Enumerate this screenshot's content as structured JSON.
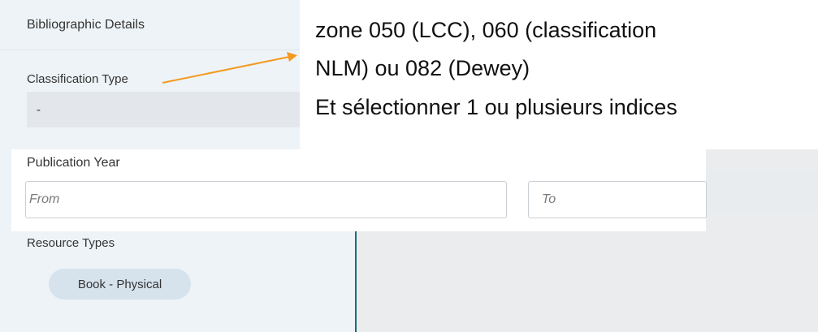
{
  "bibliographic_details": {
    "title": "Bibliographic Details",
    "classification_type": {
      "label": "Classification Type",
      "value": "-"
    }
  },
  "publication_year": {
    "label": "Publication Year",
    "from_placeholder": "From",
    "to_placeholder": "To"
  },
  "resource_types": {
    "label": "Resource Types",
    "chips": [
      "Book - Physical"
    ]
  },
  "annotation": {
    "lines": [
      "zone 050 (LCC), 060 (classification",
      "NLM) ou 082 (Dewey)",
      "Et sélectionner 1 ou plusieurs indices"
    ],
    "arrow_color": "#f39a1f"
  },
  "colors": {
    "panel_bg": "#eef3f7",
    "select_bg": "#e3e7eb",
    "chip_bg": "#d6e2ec",
    "divider": "#1f6a7a"
  }
}
